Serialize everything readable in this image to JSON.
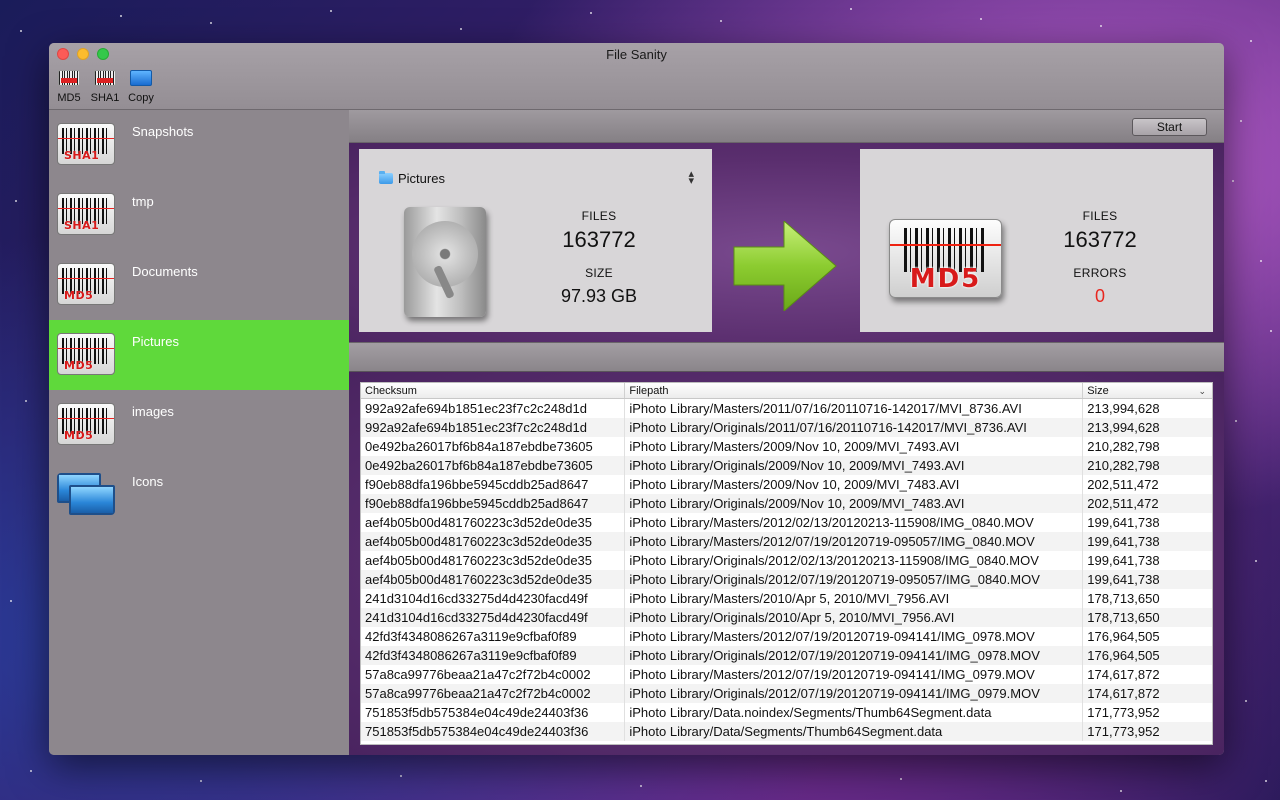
{
  "window": {
    "title": "File Sanity"
  },
  "toolbar": {
    "items": [
      {
        "label": "MD5",
        "icon": "md5-barcode-icon"
      },
      {
        "label": "SHA1",
        "icon": "sha1-barcode-icon"
      },
      {
        "label": "Copy",
        "icon": "copy-screens-icon"
      }
    ]
  },
  "sidebar": {
    "items": [
      {
        "label": "Snapshots",
        "tag": "SHA1",
        "icon": "sha1-barcode-icon"
      },
      {
        "label": "tmp",
        "tag": "SHA1",
        "icon": "sha1-barcode-icon"
      },
      {
        "label": "Documents",
        "tag": "MD5",
        "icon": "md5-barcode-icon"
      },
      {
        "label": "Pictures",
        "tag": "MD5",
        "icon": "md5-barcode-icon",
        "selected": true
      },
      {
        "label": "images",
        "tag": "MD5",
        "icon": "md5-barcode-icon"
      },
      {
        "label": "Icons",
        "tag": "",
        "icon": "copy-screens-icon"
      }
    ],
    "selected_color": "#5fd93b"
  },
  "main": {
    "start_label": "Start",
    "source": {
      "folder": "Pictures",
      "files_label": "FILES",
      "files_value": "163772",
      "size_label": "SIZE",
      "size_value": "97.93 GB"
    },
    "target": {
      "badge": "MD5",
      "files_label": "FILES",
      "files_value": "163772",
      "errors_label": "ERRORS",
      "errors_value": "0",
      "errors_color": "#e8261f"
    }
  },
  "table": {
    "headers": [
      "Checksum",
      "Filepath",
      "Size"
    ],
    "rows": [
      [
        "992a92afe694b1851ec23f7c2c248d1d",
        "iPhoto Library/Masters/2011/07/16/20110716-142017/MVI_8736.AVI",
        "213,994,628"
      ],
      [
        "992a92afe694b1851ec23f7c2c248d1d",
        "iPhoto Library/Originals/2011/07/16/20110716-142017/MVI_8736.AVI",
        "213,994,628"
      ],
      [
        "0e492ba26017bf6b84a187ebdbe73605",
        "iPhoto Library/Masters/2009/Nov 10, 2009/MVI_7493.AVI",
        "210,282,798"
      ],
      [
        "0e492ba26017bf6b84a187ebdbe73605",
        "iPhoto Library/Originals/2009/Nov 10, 2009/MVI_7493.AVI",
        "210,282,798"
      ],
      [
        "f90eb88dfa196bbe5945cddb25ad8647",
        "iPhoto Library/Masters/2009/Nov 10, 2009/MVI_7483.AVI",
        "202,511,472"
      ],
      [
        "f90eb88dfa196bbe5945cddb25ad8647",
        "iPhoto Library/Originals/2009/Nov 10, 2009/MVI_7483.AVI",
        "202,511,472"
      ],
      [
        "aef4b05b00d481760223c3d52de0de35",
        "iPhoto Library/Masters/2012/02/13/20120213-115908/IMG_0840.MOV",
        "199,641,738"
      ],
      [
        "aef4b05b00d481760223c3d52de0de35",
        "iPhoto Library/Masters/2012/07/19/20120719-095057/IMG_0840.MOV",
        "199,641,738"
      ],
      [
        "aef4b05b00d481760223c3d52de0de35",
        "iPhoto Library/Originals/2012/02/13/20120213-115908/IMG_0840.MOV",
        "199,641,738"
      ],
      [
        "aef4b05b00d481760223c3d52de0de35",
        "iPhoto Library/Originals/2012/07/19/20120719-095057/IMG_0840.MOV",
        "199,641,738"
      ],
      [
        "241d3104d16cd33275d4d4230facd49f",
        "iPhoto Library/Masters/2010/Apr 5, 2010/MVI_7956.AVI",
        "178,713,650"
      ],
      [
        "241d3104d16cd33275d4d4230facd49f",
        "iPhoto Library/Originals/2010/Apr 5, 2010/MVI_7956.AVI",
        "178,713,650"
      ],
      [
        "42fd3f4348086267a3119e9cfbaf0f89",
        "iPhoto Library/Masters/2012/07/19/20120719-094141/IMG_0978.MOV",
        "176,964,505"
      ],
      [
        "42fd3f4348086267a3119e9cfbaf0f89",
        "iPhoto Library/Originals/2012/07/19/20120719-094141/IMG_0978.MOV",
        "176,964,505"
      ],
      [
        "57a8ca99776beaa21a47c2f72b4c0002",
        "iPhoto Library/Masters/2012/07/19/20120719-094141/IMG_0979.MOV",
        "174,617,872"
      ],
      [
        "57a8ca99776beaa21a47c2f72b4c0002",
        "iPhoto Library/Originals/2012/07/19/20120719-094141/IMG_0979.MOV",
        "174,617,872"
      ],
      [
        "751853f5db575384e04c49de24403f36",
        "iPhoto Library/Data.noindex/Segments/Thumb64Segment.data",
        "171,773,952"
      ],
      [
        "751853f5db575384e04c49de24403f36",
        "iPhoto Library/Data/Segments/Thumb64Segment.data",
        "171,773,952"
      ]
    ]
  }
}
